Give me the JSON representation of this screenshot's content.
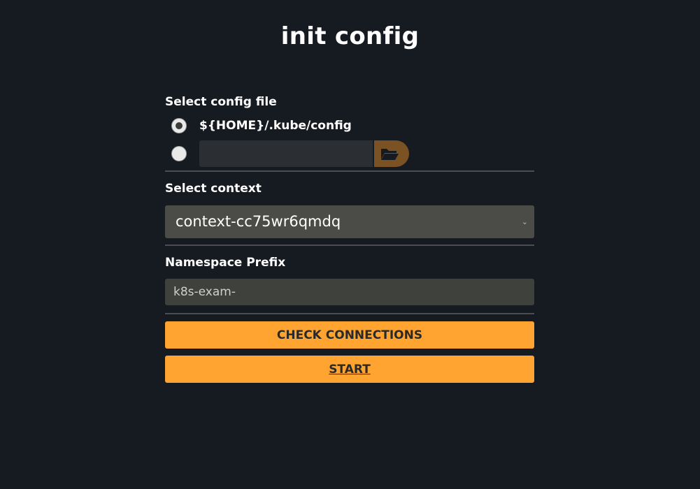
{
  "page": {
    "title": "init config"
  },
  "config_file": {
    "label": "Select config file",
    "options": [
      {
        "label": "${HOME}/.kube/config",
        "selected": true
      },
      {
        "label": "",
        "selected": false
      }
    ],
    "custom_path_value": "",
    "browse_icon": "folder-open-icon"
  },
  "context": {
    "label": "Select context",
    "selected": "context-cc75wr6qmdq",
    "dropdown_icon": "chevron-down-icon"
  },
  "namespace": {
    "label": "Namespace Prefix",
    "placeholder": "k8s-exam-"
  },
  "actions": {
    "check_label": "CHECK CONNECTIONS",
    "start_label": "START"
  },
  "colors": {
    "background": "#161a21",
    "accent": "#ffa431",
    "browse_button": "#7a5224",
    "select_bg": "#4b4c47",
    "input_bg": "#3f413c"
  }
}
